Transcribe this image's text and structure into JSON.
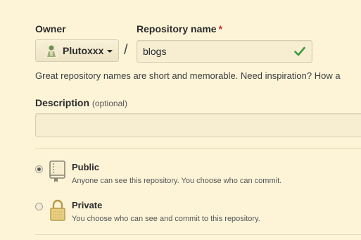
{
  "owner": {
    "label": "Owner",
    "selected": "Plutoxxx"
  },
  "repository": {
    "label": "Repository name",
    "required_mark": "*",
    "value": "blogs",
    "separator": "/",
    "valid_icon": "checkmark-icon",
    "hint": "Great repository names are short and memorable. Need inspiration? How a"
  },
  "description": {
    "label": "Description",
    "optional": "(optional)",
    "value": ""
  },
  "visibility": {
    "options": [
      {
        "title": "Public",
        "description": "Anyone can see this repository. You choose who can commit.",
        "selected": true,
        "icon": "repo-book-icon"
      },
      {
        "title": "Private",
        "description": "You choose who can see and commit to this repository.",
        "selected": false,
        "icon": "lock-icon"
      }
    ]
  },
  "colors": {
    "background": "#fdf4d8",
    "required": "#cb2431",
    "check": "#2ea44f"
  }
}
